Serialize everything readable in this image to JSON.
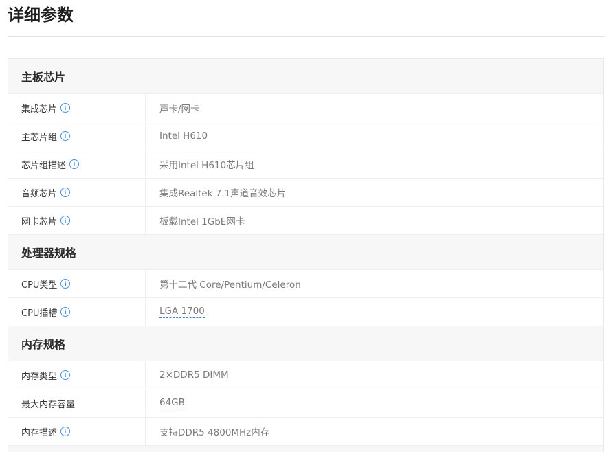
{
  "page": {
    "title": "详细参数"
  },
  "groups": [
    {
      "title": "主板芯片",
      "rows": [
        {
          "label": "集成芯片",
          "value": "声卡/网卡",
          "info": true,
          "link": false
        },
        {
          "label": "主芯片组",
          "value": "Intel H610",
          "info": true,
          "link": false
        },
        {
          "label": "芯片组描述",
          "value": "采用Intel H610芯片组",
          "info": true,
          "link": false
        },
        {
          "label": "音频芯片",
          "value": "集成Realtek 7.1声道音效芯片",
          "info": true,
          "link": false
        },
        {
          "label": "网卡芯片",
          "value": "板载Intel 1GbE网卡",
          "info": true,
          "link": false
        }
      ]
    },
    {
      "title": "处理器规格",
      "rows": [
        {
          "label": "CPU类型",
          "value": "第十二代 Core/Pentium/Celeron",
          "info": true,
          "link": false
        },
        {
          "label": "CPU插槽",
          "value": "LGA 1700",
          "info": true,
          "link": true
        }
      ]
    },
    {
      "title": "内存规格",
      "rows": [
        {
          "label": "内存类型",
          "value": "2×DDR5 DIMM",
          "info": true,
          "link": false
        },
        {
          "label": "最大内存容量",
          "value": "64GB",
          "info": false,
          "link": true
        },
        {
          "label": "内存描述",
          "value": "支持DDR5 4800MHz内存",
          "info": true,
          "link": false
        }
      ]
    }
  ],
  "icons": {
    "info_glyph": "i",
    "info_color": "#4a8fd9"
  }
}
